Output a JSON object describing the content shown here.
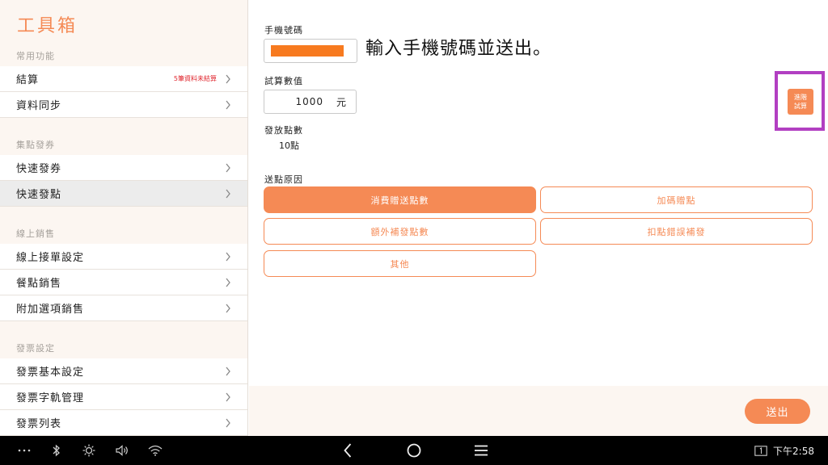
{
  "sidebar": {
    "title": "工具箱",
    "sections": [
      {
        "label": "常用功能",
        "items": [
          {
            "label": "結算",
            "badge": "5筆資料未結算"
          },
          {
            "label": "資料同步"
          }
        ]
      },
      {
        "label": "集點發券",
        "items": [
          {
            "label": "快速發券"
          },
          {
            "label": "快速發點",
            "active": true
          }
        ]
      },
      {
        "label": "線上銷售",
        "items": [
          {
            "label": "線上接單設定"
          },
          {
            "label": "餐點銷售"
          },
          {
            "label": "附加選項銷售"
          }
        ]
      },
      {
        "label": "發票設定",
        "items": [
          {
            "label": "發票基本設定"
          },
          {
            "label": "發票字軌管理"
          },
          {
            "label": "發票列表"
          }
        ]
      }
    ]
  },
  "main": {
    "phone_label": "手機號碼",
    "phone_hint": "輸入手機號碼並送出。",
    "amount_label": "試算數值",
    "amount_value": "1000",
    "amount_unit": "元",
    "points_label": "發放點數",
    "points_value": "10點",
    "advanced_button": "進階\n試算",
    "reason_label": "送點原因",
    "reasons": [
      {
        "label": "消費贈送點數",
        "selected": true
      },
      {
        "label": "加碼贈點"
      },
      {
        "label": "額外補發點數"
      },
      {
        "label": "扣點錯誤補發"
      },
      {
        "label": "其他"
      }
    ],
    "submit": "送出"
  },
  "system_bar": {
    "time": "下午2:58",
    "icons": [
      "more-icon",
      "bluetooth-icon",
      "brightness-icon",
      "volume-icon",
      "wifi-icon",
      "back-icon",
      "home-icon",
      "recents-icon",
      "screen-number-icon"
    ]
  },
  "colors": {
    "accent": "#f58a55",
    "highlight": "#b23fc2",
    "badge": "#e0262e"
  }
}
